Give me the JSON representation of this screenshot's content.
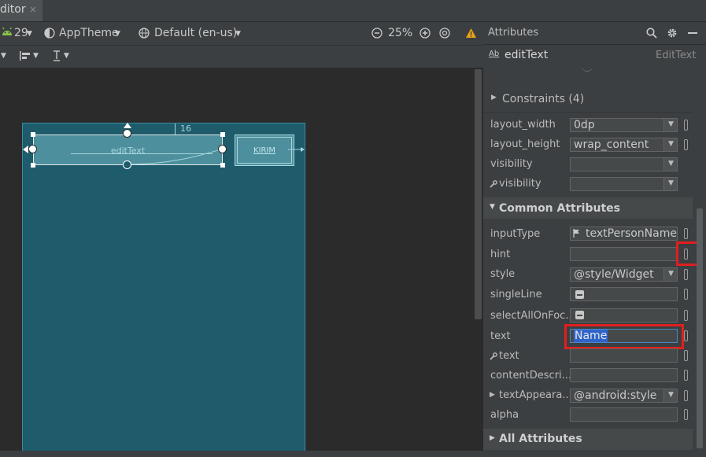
{
  "tab": {
    "label": "ditor",
    "close": "×"
  },
  "toolbar": {
    "api_level": "29",
    "theme": "AppTheme",
    "locale": "Default (en-us)",
    "zoom": "25%"
  },
  "canvas": {
    "edittext_label": "editText",
    "button_label": "KIRIM",
    "margin_value": "16"
  },
  "panel": {
    "title": "Attributes",
    "component": {
      "id": "editText",
      "type": "EditText",
      "badge": "Ab"
    },
    "constraints_label": "Constraints (4)",
    "layout": [
      {
        "label": "layout_width",
        "value": "0dp"
      },
      {
        "label": "layout_height",
        "value": "wrap_content"
      },
      {
        "label": "visibility",
        "value": ""
      },
      {
        "label": "visibility",
        "value": ""
      }
    ],
    "common_label": "Common Attributes",
    "common": {
      "inputType": {
        "label": "inputType",
        "value": "textPersonName"
      },
      "hint": {
        "label": "hint",
        "value": ""
      },
      "style": {
        "label": "style",
        "value": "@style/Widget"
      },
      "singleLine": {
        "label": "singleLine"
      },
      "selectAllOnFocus": {
        "label": "selectAllOnFoc..."
      },
      "text": {
        "label": "text",
        "value": "Name"
      },
      "tools_text": {
        "label": "text",
        "value": ""
      },
      "contentDescription": {
        "label": "contentDescri...",
        "value": ""
      },
      "textAppearance": {
        "label": "textAppeara...",
        "value": "@android:style"
      },
      "alpha": {
        "label": "alpha",
        "value": ""
      }
    },
    "all_label": "All Attributes"
  }
}
